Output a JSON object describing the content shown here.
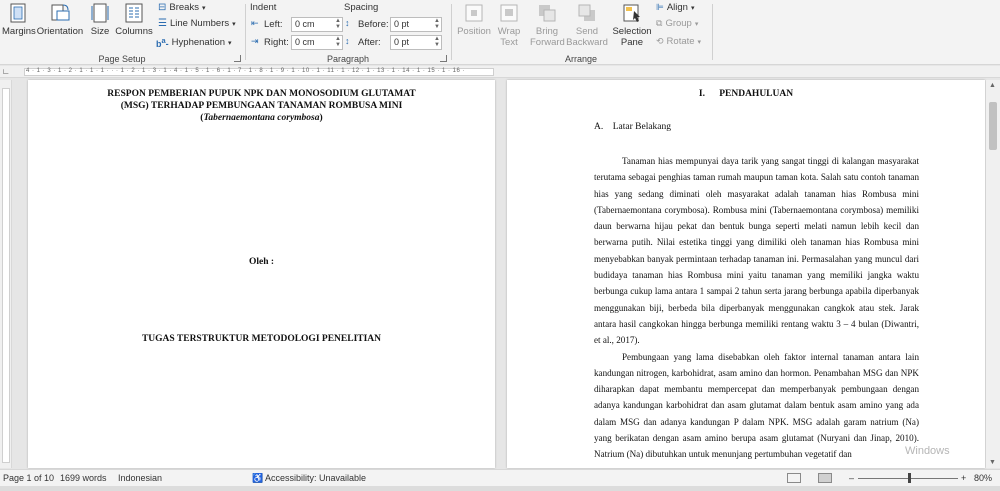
{
  "ribbon": {
    "page_setup": {
      "margins": "Margins",
      "orientation": "Orientation",
      "size": "Size",
      "columns": "Columns",
      "breaks": "Breaks",
      "line_numbers": "Line Numbers",
      "hyphenation": "Hyphenation",
      "group_label": "Page Setup"
    },
    "paragraph": {
      "indent_label": "Indent",
      "spacing_label": "Spacing",
      "left_label": "Left:",
      "right_label": "Right:",
      "before_label": "Before:",
      "after_label": "After:",
      "left_value": "0 cm",
      "right_value": "0 cm",
      "before_value": "0 pt",
      "after_value": "0 pt",
      "group_label": "Paragraph"
    },
    "arrange": {
      "position": "Position",
      "wrap_text": "Wrap Text",
      "bring_forward": "Bring Forward",
      "send_backward": "Send Backward",
      "selection_pane": "Selection Pane",
      "align": "Align",
      "group": "Group",
      "rotate": "Rotate",
      "group_label": "Arrange"
    }
  },
  "ruler": {
    "ticks": "4 · 1 · 3 · 1 · 2 · 1 · 1 · 1 · · · 1 · 2 · 1 · 3 · 1 · 4 · 1 · 5 · 1 · 6 · 1 · 7 · 1 · 8 · 1 · 9 · 1 · 10 · 1 · 11 · 1 · 12 · 1 · 13 · 1 · 14 · 1 · 15 · 1 · 16 ·"
  },
  "page1": {
    "title_line1": "RESPON PEMBERIAN PUPUK NPK DAN MONOSODIUM GLUTAMAT",
    "title_line2": "(MSG) TERHADAP PEMBUNGAAN TANAMAN ROMBUSA MINI",
    "title_line3": "Tabernaemontana corymbosa",
    "oleh": "Oleh :",
    "tugas": "TUGAS TERSTRUKTUR METODOLOGI PENELITIAN"
  },
  "page2": {
    "heading": "I.      PENDAHULUAN",
    "subheading": "A.    Latar Belakang",
    "paragraph1": "Tanaman hias mempunyai daya tarik yang sangat tinggi di kalangan masyarakat terutama sebagai penghias taman rumah maupun taman kota. Salah satu contoh tanaman hias yang sedang diminati oleh masyarakat adalah tanaman hias Rombusa mini (Tabernaemontana corymbosa). Rombusa mini (Tabernaemontana corymbosa) memiliki daun berwarna hijau pekat dan bentuk bunga seperti melati namun lebih kecil dan berwarna putih. Nilai estetika tinggi yang dimiliki oleh tanaman hias Rombusa mini menyebabkan banyak permintaan terhadap tanaman ini. Permasalahan yang muncul dari budidaya tanaman hias Rombusa mini yaitu tanaman yang memiliki jangka waktu berbunga cukup lama antara 1 sampai 2 tahun serta jarang berbunga apabila diperbanyak menggunakan biji, berbeda bila diperbanyak menggunakan cangkok atau stek. Jarak antara hasil cangkokan hingga berbunga memiliki rentang waktu 3 – 4 bulan (Diwantri, et al., 2017).",
    "paragraph2": "Pembungaan yang lama disebabkan oleh faktor internal tanaman antara lain kandungan nitrogen, karbohidrat, asam amino dan hormon. Penambahan MSG dan NPK diharapkan dapat membantu mempercepat dan memperbanyak pembungaan dengan adanya kandungan karbohidrat dan asam glutamat dalam bentuk asam amino yang ada dalam MSG dan adanya kandungan P dalam NPK. MSG adalah garam natrium (Na) yang berikatan dengan asam amino berupa asam glutamat (Nuryani dan Jinap, 2010). Natrium (Na) dibutuhkan untuk menunjang pertumbuhan vegetatif dan"
  },
  "watermark": "Windows",
  "status": {
    "page": "Page 1 of 10",
    "words": "1699 words",
    "language": "Indonesian",
    "accessibility": "Accessibility: Unavailable",
    "zoom": "80%",
    "zoom_minus": "–",
    "zoom_plus": "+"
  }
}
